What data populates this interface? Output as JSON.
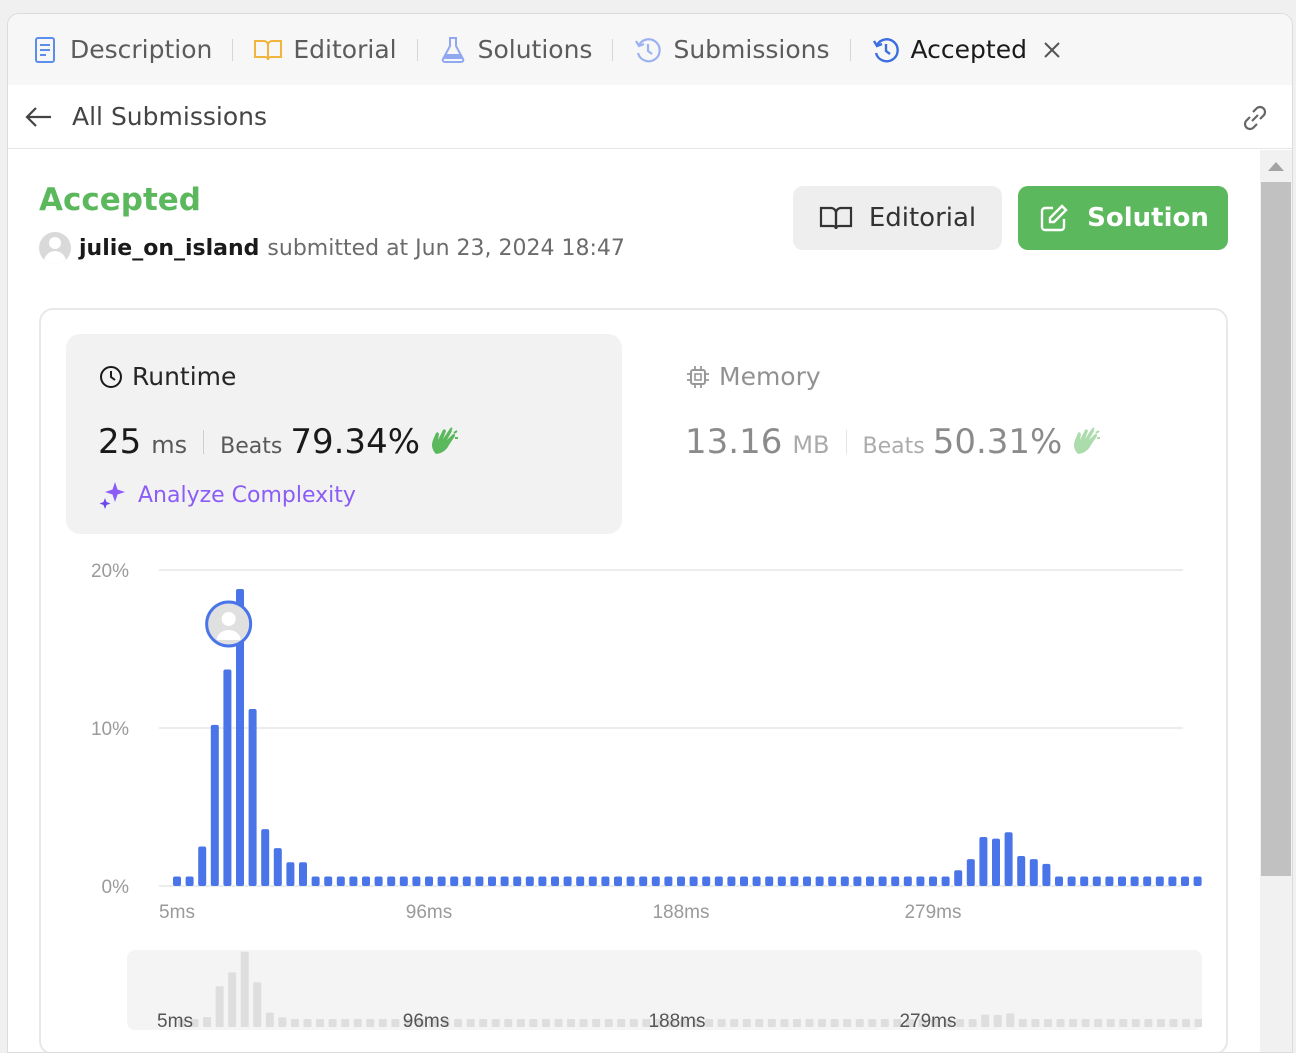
{
  "tabs": [
    {
      "label": "Description",
      "icon": "description-icon"
    },
    {
      "label": "Editorial",
      "icon": "book-icon"
    },
    {
      "label": "Solutions",
      "icon": "flask-icon"
    },
    {
      "label": "Submissions",
      "icon": "history-icon"
    },
    {
      "label": "Accepted",
      "icon": "history-icon",
      "active": true
    }
  ],
  "subbar": {
    "back_label": "All Submissions"
  },
  "submission": {
    "status": "Accepted",
    "user": "julie_on_island",
    "submitted_text": "submitted at Jun 23, 2024 18:47"
  },
  "actions": {
    "editorial_label": "Editorial",
    "solution_label": "Solution"
  },
  "runtime": {
    "title": "Runtime",
    "value": "25",
    "unit": "ms",
    "beats_label": "Beats",
    "beats_pct": "79.34%",
    "analyze_label": "Analyze Complexity"
  },
  "memory": {
    "title": "Memory",
    "value": "13.16",
    "unit": "MB",
    "beats_label": "Beats",
    "beats_pct": "50.31%"
  },
  "colors": {
    "accent_green": "#5cb85c",
    "bar_blue": "#4a75e8",
    "analyze_purple": "#8b5cf6",
    "mini_bar": "#dedede"
  },
  "chart_data": {
    "type": "bar",
    "title": "",
    "xlabel": "",
    "ylabel": "",
    "ylim": [
      0,
      20
    ],
    "y_ticks": [
      "0%",
      "10%",
      "20%"
    ],
    "x_tick_labels": [
      "5ms",
      "96ms",
      "188ms",
      "279ms"
    ],
    "x_tick_indices": [
      0,
      20,
      40,
      60
    ],
    "highlight_index": 5,
    "values": [
      0.6,
      0.6,
      2.5,
      10.2,
      13.7,
      18.8,
      11.2,
      3.6,
      2.4,
      1.5,
      1.5,
      0.6,
      0.6,
      0.6,
      0.6,
      0.6,
      0.6,
      0.6,
      0.6,
      0.6,
      0.6,
      0.6,
      0.6,
      0.6,
      0.6,
      0.6,
      0.6,
      0.6,
      0.6,
      0.6,
      0.6,
      0.6,
      0.6,
      0.6,
      0.6,
      0.6,
      0.6,
      0.6,
      0.6,
      0.6,
      0.6,
      0.6,
      0.6,
      0.6,
      0.6,
      0.6,
      0.6,
      0.6,
      0.6,
      0.6,
      0.6,
      0.6,
      0.6,
      0.6,
      0.6,
      0.6,
      0.6,
      0.6,
      0.6,
      0.6,
      0.6,
      0.6,
      1.0,
      1.7,
      3.1,
      3.0,
      3.4,
      1.9,
      1.7,
      1.4,
      0.6,
      0.6,
      0.6,
      0.6,
      0.6,
      0.6,
      0.6,
      0.6,
      0.6,
      0.6,
      0.6,
      0.6
    ]
  }
}
